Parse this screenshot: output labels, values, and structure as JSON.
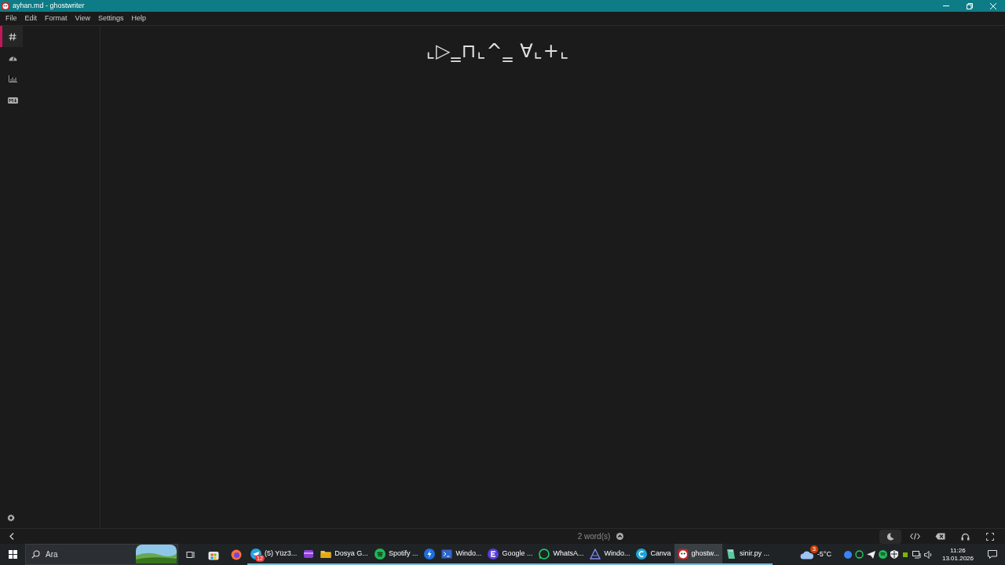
{
  "window": {
    "title": "ayhan.md - ghostwriter"
  },
  "menu": [
    "File",
    "Edit",
    "Format",
    "View",
    "Settings",
    "Help"
  ],
  "sidebar_tabs": [
    {
      "kind": "outline",
      "selected": true
    },
    {
      "kind": "session",
      "selected": false
    },
    {
      "kind": "statistics",
      "selected": false
    },
    {
      "kind": "cheatsheet",
      "selected": false
    }
  ],
  "editor": {
    "text": "⌞▷‗⊓⌞^‗ ∀⌞+⌞"
  },
  "status_bar": {
    "word_count": "2 word(s)"
  },
  "taskbar": {
    "search_placeholder": "Ara",
    "apps": [
      {
        "kind": "telegram",
        "label": "(5) Yüz3...",
        "badge": "12",
        "selected": false
      },
      {
        "kind": "clapper",
        "selected": false
      },
      {
        "kind": "folder",
        "label": "Dosya G...",
        "selected": false
      },
      {
        "kind": "spotify",
        "label": "Spotify ...",
        "selected": false
      },
      {
        "kind": "bolt",
        "selected": false
      },
      {
        "kind": "terminal",
        "label": "Windo...",
        "selected": false
      },
      {
        "kind": "google",
        "label": "Google ...",
        "selected": false
      },
      {
        "kind": "whatsapp",
        "label": "WhatsA...",
        "selected": false
      },
      {
        "kind": "windows",
        "label": "Windo...",
        "selected": false
      },
      {
        "kind": "canva",
        "label": "Canva",
        "selected": false
      },
      {
        "kind": "ghost",
        "label": "ghostw...",
        "selected": true
      },
      {
        "kind": "notes",
        "label": "sinir.py ...",
        "selected": false
      }
    ],
    "weather": {
      "temperature": "-5°C",
      "badge": "3"
    },
    "time": "11:26",
    "date": "13.01.2026"
  }
}
